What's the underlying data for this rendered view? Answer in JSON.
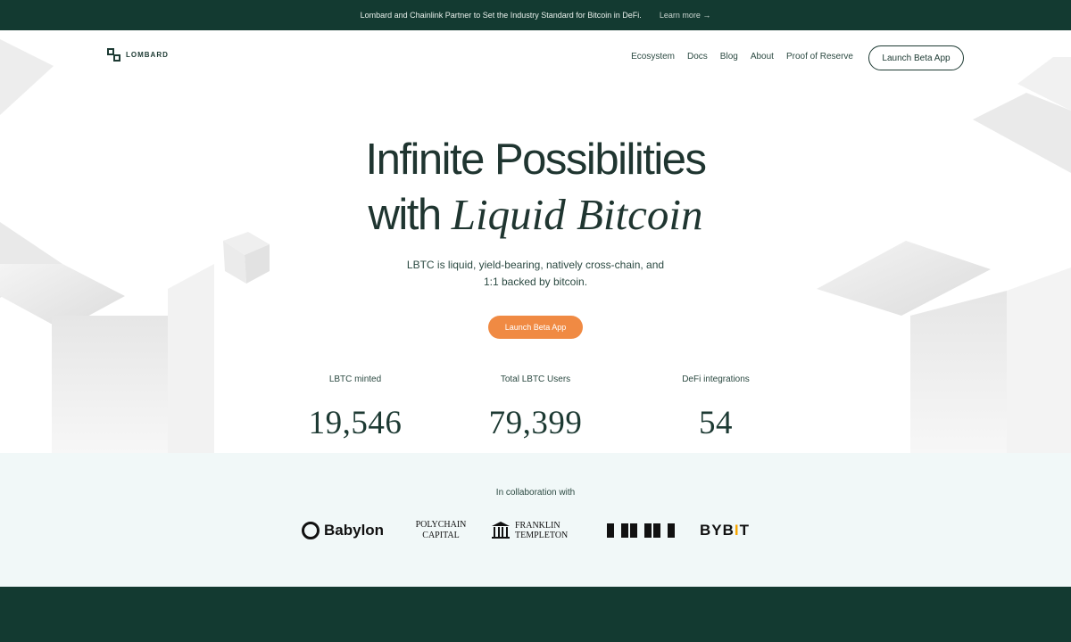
{
  "announcement": {
    "text": "Lombard and Chainlink Partner to Set the Industry Standard for Bitcoin in DeFi.",
    "link": "Learn more →"
  },
  "nav": {
    "brand": "LOMBARD",
    "links": [
      "Ecosystem",
      "Docs",
      "Blog",
      "About",
      "Proof of Reserve"
    ],
    "launch": "Launch Beta App"
  },
  "hero": {
    "line1": "Infinite Possibilities",
    "line2_plain": "with ",
    "line2_italic": "Liquid Bitcoin",
    "subtitle": "LBTC is liquid, yield-bearing, natively cross-chain, and 1:1 backed by bitcoin.",
    "cta": "Launch Beta App"
  },
  "stats": [
    {
      "label": "LBTC minted",
      "value": "19,546"
    },
    {
      "label": "Total LBTC Users",
      "value": "79,399"
    },
    {
      "label": "DeFi integrations",
      "value": "54"
    }
  ],
  "collab": {
    "title": "In collaboration with",
    "partners": {
      "babylon": "Babylon",
      "polychain_1": "POLYCHAIN",
      "polychain_2": "CAPITAL",
      "franklin_1": "FRANKLIN",
      "franklin_2": "TEMPLETON",
      "bybit_a": "BYB",
      "bybit_b": "I",
      "bybit_c": "T"
    }
  },
  "colors": {
    "dark_green": "#133a31",
    "accent_orange": "#f08a43",
    "collab_bg": "#f1f8f8"
  }
}
